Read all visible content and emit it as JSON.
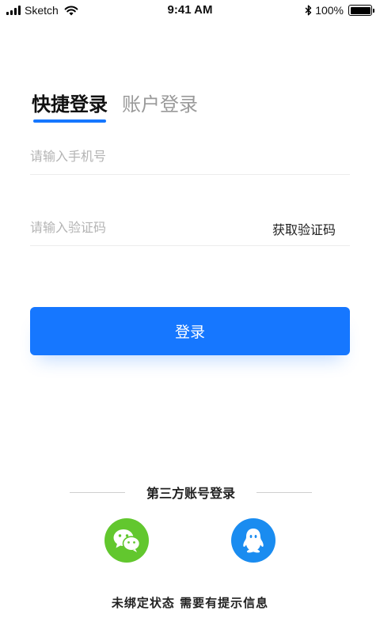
{
  "status_bar": {
    "carrier": "Sketch",
    "time": "9:41 AM",
    "battery": "100%",
    "icons": [
      "signal-icon",
      "wifi-icon",
      "bluetooth-icon",
      "battery-icon"
    ]
  },
  "tabs": [
    {
      "label": "快捷登录",
      "active": true
    },
    {
      "label": "账户登录",
      "active": false
    }
  ],
  "phone_field": {
    "placeholder": "请输入手机号",
    "value": ""
  },
  "code_field": {
    "placeholder": "请输入验证码",
    "value": "",
    "get_code_label": "获取验证码"
  },
  "login_button": {
    "label": "登录"
  },
  "third_party": {
    "title": "第三方账号登录",
    "providers": [
      {
        "icon": "wechat-icon",
        "color": "#62c72e"
      },
      {
        "icon": "qq-icon",
        "color": "#1a8cf0"
      }
    ]
  },
  "hint": "未绑定状态 需要有提示信息",
  "colors": {
    "accent": "#1677ff",
    "placeholder": "#b4b4b4",
    "inactive_tab": "#9a9a9a"
  }
}
